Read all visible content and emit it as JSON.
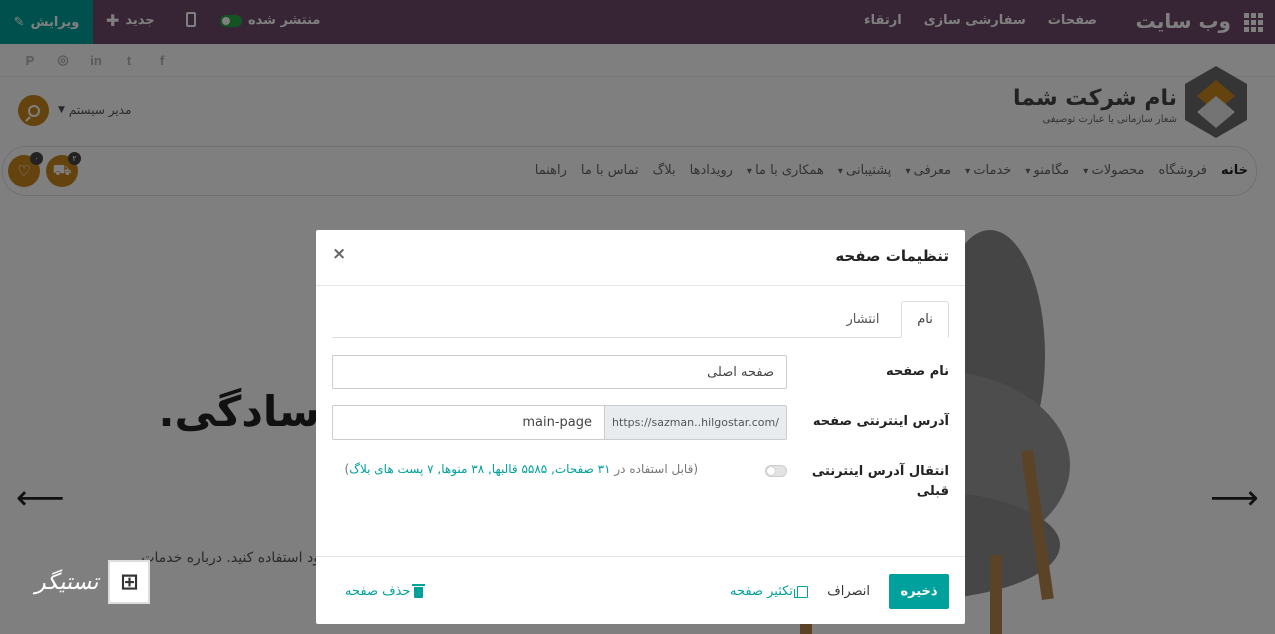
{
  "topbar": {
    "brand": "وب سایت",
    "menu": [
      "صفحات",
      "سفارشی سازی",
      "ارتقاء"
    ],
    "edit_label": "ویرایش",
    "new_label": "جدید",
    "publish_label": "منتشر شده",
    "published": true,
    "bar_color": "#6f4a6b",
    "accent_color": "#00a09d"
  },
  "social_icons": [
    "facebook-icon",
    "twitter-icon",
    "linkedin-icon",
    "instagram-icon",
    "pinterest-icon"
  ],
  "header": {
    "company_name": "نام شرکت شما",
    "tagline": "شعار سازمانی یا عبارت توصیفی",
    "user_name": "مدیر سیستم",
    "brand_color": "#c8871d"
  },
  "nav": {
    "items": [
      {
        "label": "خانه",
        "dropdown": false,
        "active": true
      },
      {
        "label": "فروشگاه",
        "dropdown": false
      },
      {
        "label": "محصولات",
        "dropdown": true
      },
      {
        "label": "مگامنو",
        "dropdown": true
      },
      {
        "label": "خدمات",
        "dropdown": true
      },
      {
        "label": "معرفی",
        "dropdown": true
      },
      {
        "label": "پشتیبانی",
        "dropdown": true
      },
      {
        "label": "همکاری با ما",
        "dropdown": true
      },
      {
        "label": "رویدادها",
        "dropdown": false
      },
      {
        "label": "بلاگ",
        "dropdown": false
      },
      {
        "label": "تماس با ما",
        "dropdown": false
      },
      {
        "label": "راهنما",
        "dropdown": false
      }
    ],
    "cart_count": "۲",
    "wishlist_count": "۰"
  },
  "hero": {
    "title": "سادگی...",
    "subtitle": "ود استفاده کنید. درباره خدمات"
  },
  "watermark": {
    "text": "تستیگر"
  },
  "modal": {
    "title": "تنظیمات صفحه",
    "tabs": [
      "نام",
      "انتشار"
    ],
    "fields": {
      "page_name_label": "نام صفحه",
      "page_name_value": "صفحه اصلی",
      "url_label": "آدرس اینترنتی صفحه",
      "url_prefix": "https://sazman..hilgostar.com/",
      "url_slug": "main-page",
      "redirect_label": "انتقال آدرس اینترنتی قبلی",
      "usage_prefix": "(قابل استفاده در ",
      "usage_links": "۳۱ صفحات, ۵۵۸۵ قالبها, ۳۸ منوها, ۷ پست های بلاگ",
      "usage_suffix": ")"
    },
    "buttons": {
      "save": "ذخیره",
      "cancel": "انصراف",
      "duplicate": "تکثیر صفحه",
      "delete": "حذف صفحه"
    }
  }
}
